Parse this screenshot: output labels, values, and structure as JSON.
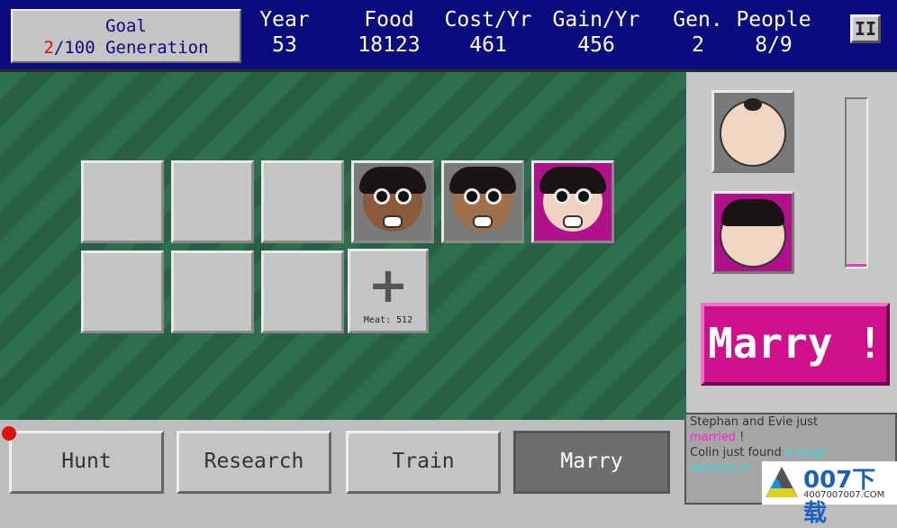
{
  "header": {
    "goal_label": "Goal",
    "goal_current": "2",
    "goal_rest": "/100 Generation",
    "stats": [
      {
        "label": "Year",
        "value": "53"
      },
      {
        "label": "Food",
        "value": "18123"
      },
      {
        "label": "Cost/Yr",
        "value": "461"
      },
      {
        "label": "Gain/Yr",
        "value": "456"
      },
      {
        "label": "Gen.",
        "value": "2"
      },
      {
        "label": "People",
        "value": "8/9"
      }
    ],
    "pause_label": "II"
  },
  "grid": {
    "add_symbol": "+",
    "add_cost": "Meat: 512"
  },
  "side": {
    "marry_button": "Marry !",
    "bar_level": 0.02
  },
  "tabs": [
    {
      "label": "Hunt"
    },
    {
      "label": "Research"
    },
    {
      "label": "Train"
    },
    {
      "label": "Marry",
      "active": true
    }
  ],
  "log": {
    "l1": "Stephan and Evie just",
    "l2a": "married",
    "l2b": " !",
    "l3a": "Colin just found ",
    "l3b": "a huge",
    "l4": "amount of"
  },
  "watermark": {
    "brand": "007下载",
    "url": "4007007007.COM"
  },
  "colors": {
    "header": "#0b0b80",
    "accent": "#d0108a",
    "field": "#2d6e4e"
  }
}
